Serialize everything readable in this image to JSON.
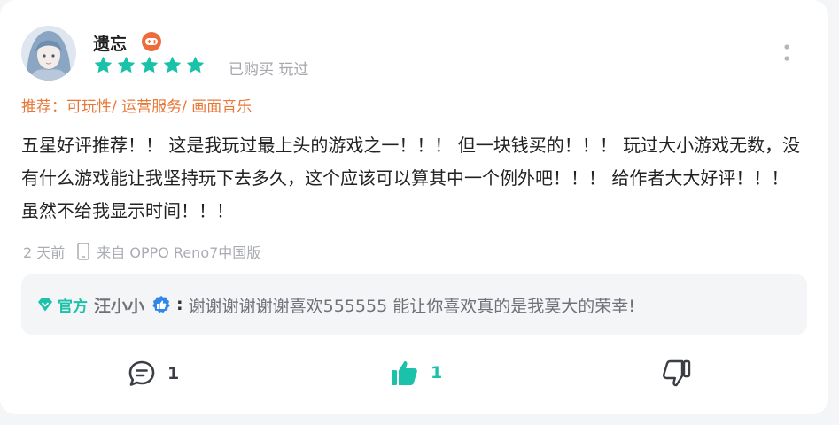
{
  "review": {
    "user": {
      "name": "遗忘",
      "badge_icon": "gamepad-badge-icon"
    },
    "rating": 5,
    "purchase_status": "已购买 玩过",
    "recommend": "推荐：可玩性/ 运营服务/ 画面音乐",
    "content": "五星好评推荐！！ 这是我玩过最上头的游戏之一！！！ 但一块钱买的！！！ 玩过大小游戏无数，没有什么游戏能让我坚持玩下去多久，这个应该可以算其中一个例外吧！！！ 给作者大大好评！！！ 虽然不给我显示时间！！！",
    "time": "2 天前",
    "device": "来自 OPPO Reno7中国版"
  },
  "reply": {
    "official_label": "官方",
    "developer": "汪小小",
    "separator": ":",
    "text": "谢谢谢谢谢谢喜欢555555 能让你喜欢真的是我莫大的荣幸!"
  },
  "actions": {
    "comment_count": "1",
    "like_count": "1"
  },
  "colors": {
    "accent": "#19c2a8",
    "recommend": "#e8773a",
    "muted": "#a9acb2"
  }
}
